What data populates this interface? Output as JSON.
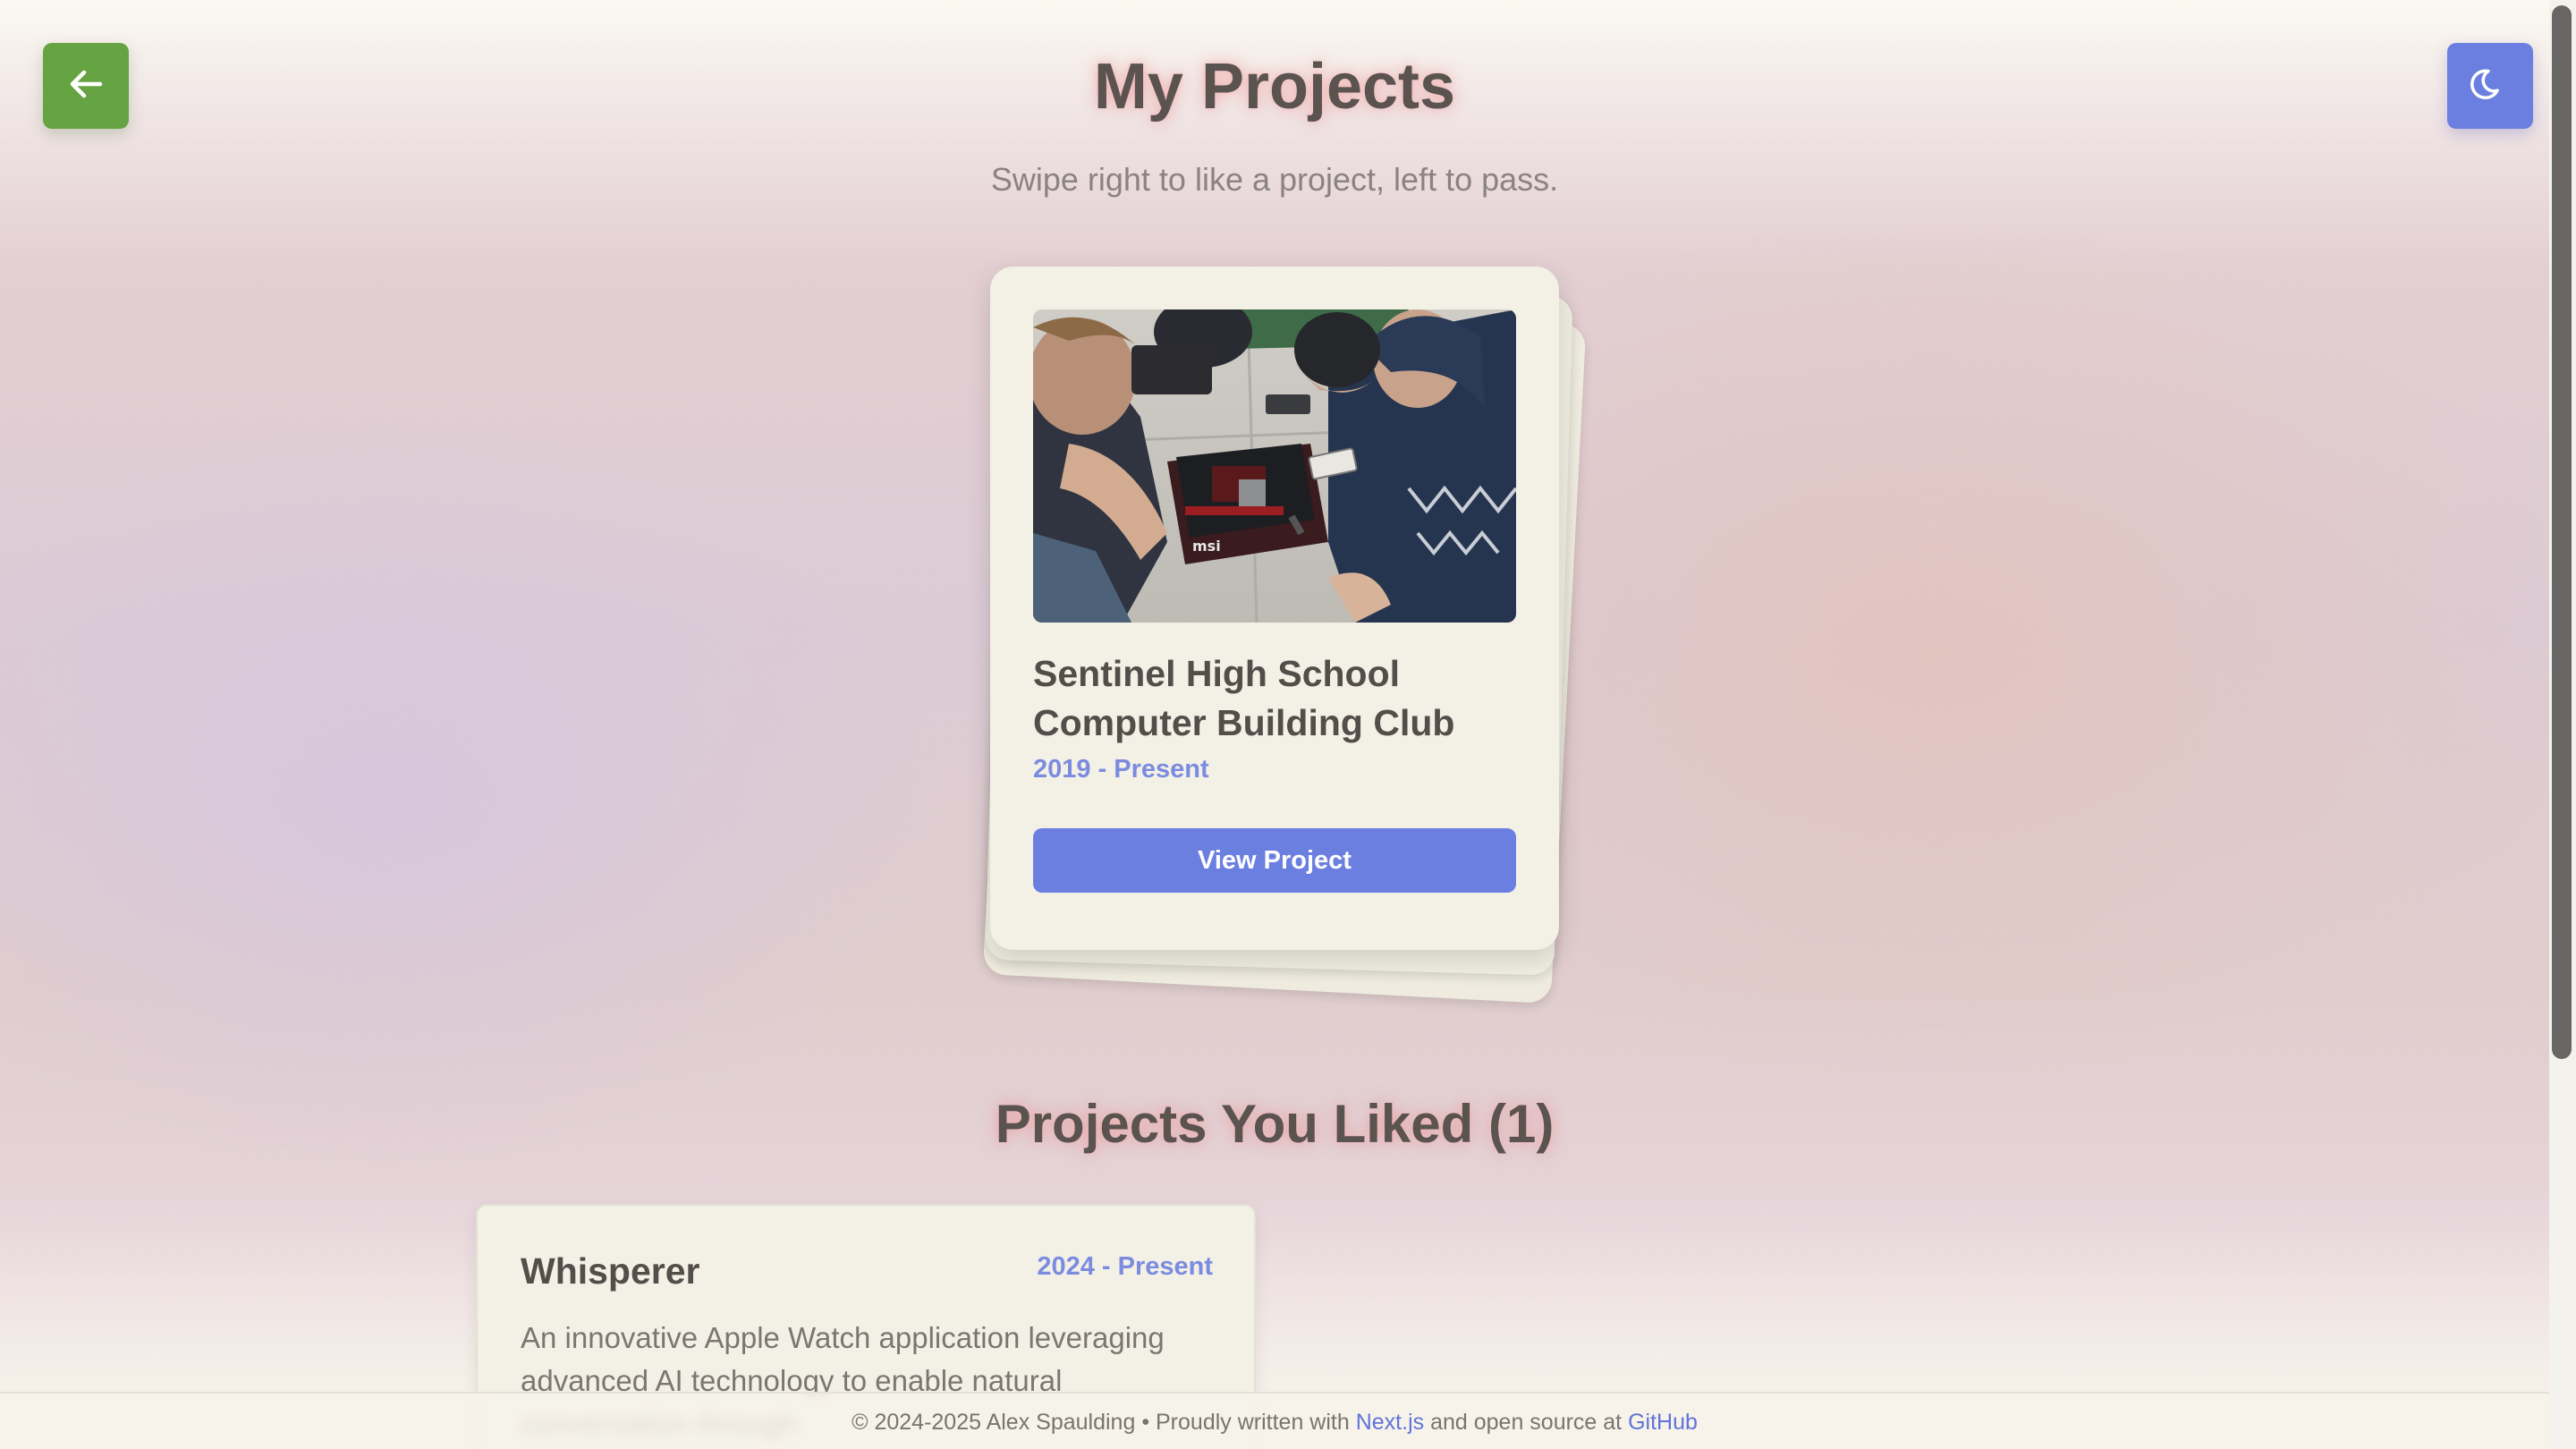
{
  "header": {
    "title": "My Projects",
    "subtitle": "Swipe right to like a project, left to pass."
  },
  "controls": {
    "back_icon": "arrow-left-icon",
    "theme_icon": "moon-icon"
  },
  "current_project": {
    "title": "Sentinel High School Computer Building Club",
    "date": "2019 - Present",
    "button_label": "View Project"
  },
  "liked": {
    "heading": "Projects You Liked (1)",
    "items": [
      {
        "name": "Whisperer",
        "date": "2024 - Present",
        "description": "An innovative Apple Watch application leveraging advanced AI technology to enable natural conversation through"
      }
    ]
  },
  "footer": {
    "prefix": "© 2024-2025 Alex Spaulding • Proudly written with ",
    "nextjs_link": "Next.js",
    "middle": " and open source at ",
    "github_link": "GitHub"
  },
  "colors": {
    "back_button": "#66a443",
    "accent": "#6b7fe0",
    "card": "#f3f1e6"
  }
}
